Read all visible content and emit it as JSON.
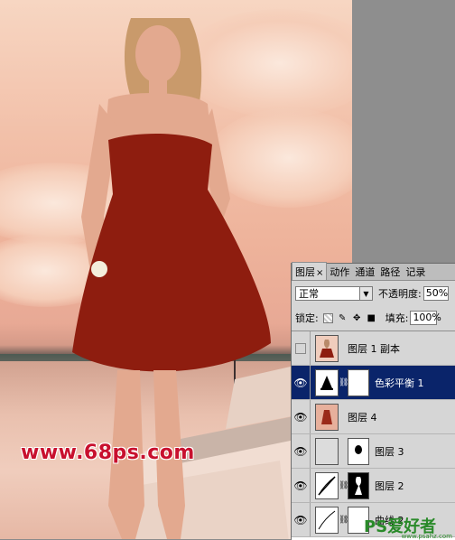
{
  "watermark": {
    "text": "www.68ps.com"
  },
  "panel": {
    "tabs": [
      {
        "label": "图层",
        "active": true
      },
      {
        "label": "动作"
      },
      {
        "label": "通道"
      },
      {
        "label": "路径"
      },
      {
        "label": "记录"
      }
    ],
    "close_glyph": "×",
    "blend_mode": "正常",
    "opacity_label": "不透明度:",
    "opacity_value": "50%",
    "lock_label": "锁定:",
    "fill_label": "填充:",
    "fill_value": "100%",
    "layers": [
      {
        "name": "图层 1 副本",
        "visible": false,
        "selected": false
      },
      {
        "name": "色彩平衡 1",
        "visible": true,
        "selected": true
      },
      {
        "name": "图层 4",
        "visible": true,
        "selected": false
      },
      {
        "name": "图层 3",
        "visible": true,
        "selected": false
      },
      {
        "name": "图层 2",
        "visible": true,
        "selected": false
      },
      {
        "name": "曲线 2",
        "visible": true,
        "selected": false
      }
    ]
  },
  "logo": {
    "text": "PS爱好者",
    "sub": "www.psahz.com"
  },
  "colors": {
    "selection": "#0a246a",
    "panel_bg": "#d6d6d6",
    "watermark": "#c8102e"
  }
}
